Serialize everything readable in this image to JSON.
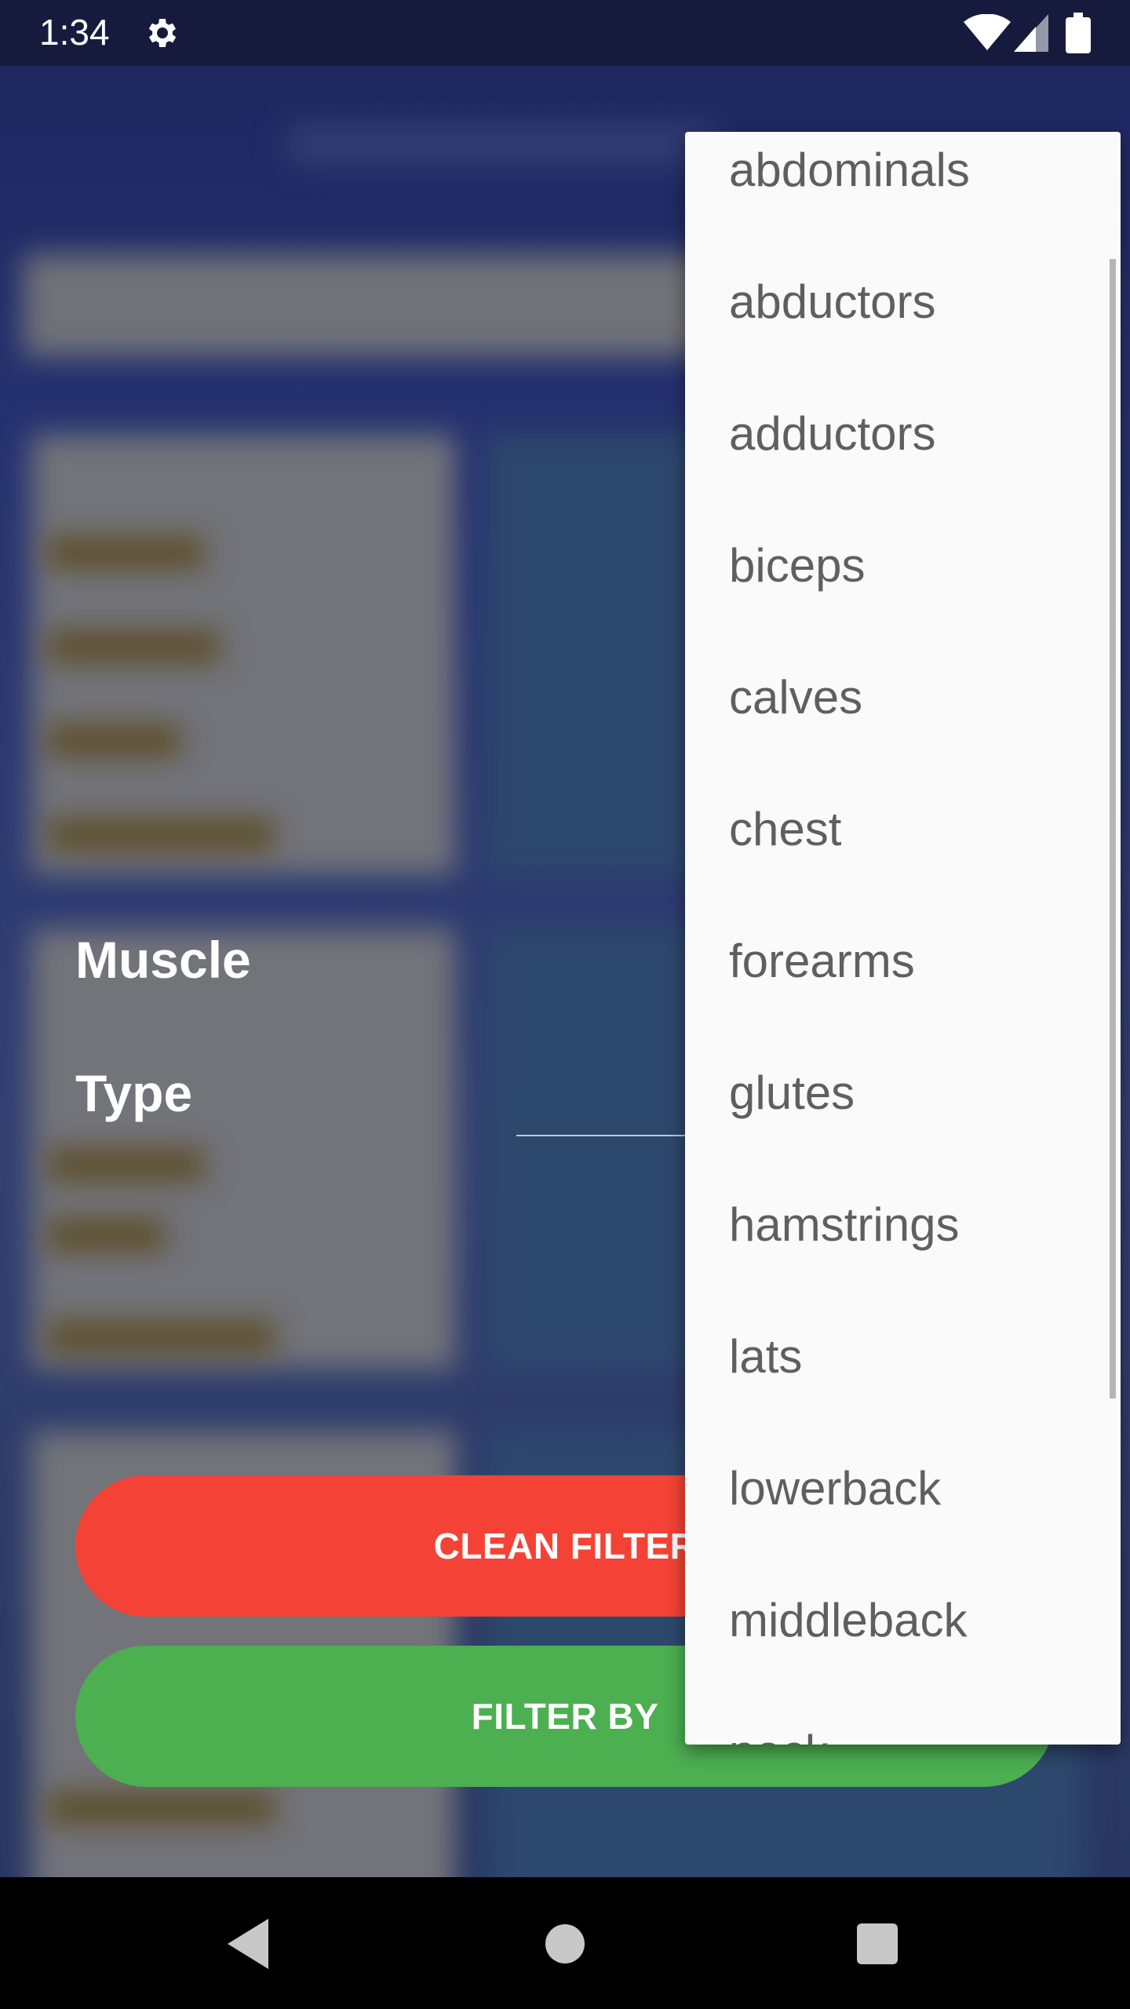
{
  "status_bar": {
    "time": "1:34",
    "icons": [
      "gear-icon",
      "wifi-icon",
      "cell-signal-icon",
      "battery-icon"
    ]
  },
  "dialog": {
    "fields": {
      "muscle_label": "Muscle",
      "type_label": "Type"
    },
    "buttons": {
      "clean_label": "CLEAN FILTER",
      "filter_label": "FILTER BY"
    }
  },
  "dropdown": {
    "options": [
      "abdominals",
      "abductors",
      "adductors",
      "biceps",
      "calves",
      "chest",
      "forearms",
      "glutes",
      "hamstrings",
      "lats",
      "lowerback",
      "middleback",
      "neck"
    ]
  },
  "nav_bar": {
    "icons": [
      "back-icon",
      "home-icon",
      "recents-icon"
    ]
  },
  "colors": {
    "status_bar": "#161b3e",
    "clean_button": "#f44336",
    "filter_button": "#4caf50",
    "dropdown_bg": "#fafafa",
    "option_text": "#5f5f5f"
  }
}
